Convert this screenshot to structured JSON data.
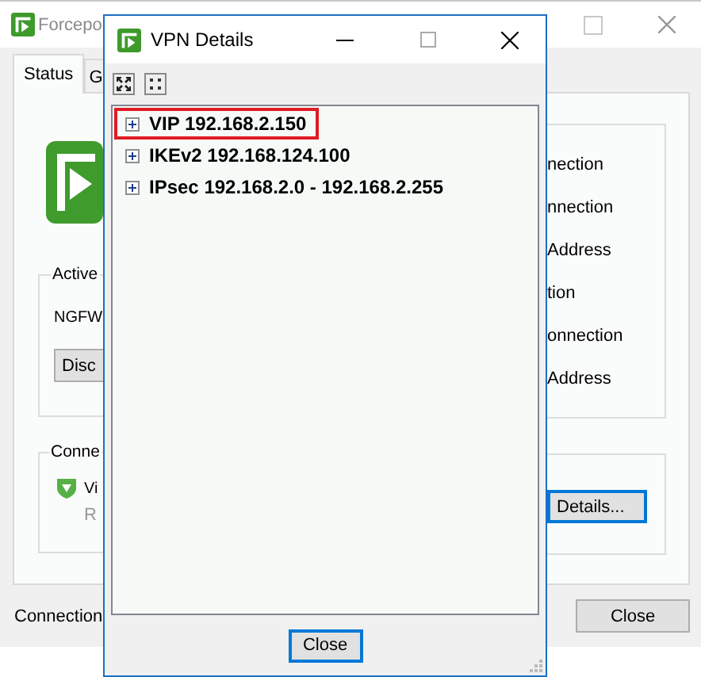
{
  "main_window": {
    "title": "Forcepo",
    "tabs": [
      {
        "label": "Status",
        "selected": true
      },
      {
        "label": "G",
        "selected": false
      }
    ],
    "active_group": {
      "title": "Active",
      "gateway": "NGFW",
      "button": "Disc"
    },
    "connection_group": {
      "title": "Conne",
      "name": "Vi",
      "detail": "R"
    },
    "status_labels": [
      "nection",
      "nnection",
      "Address",
      "tion",
      "onnection",
      "Address"
    ],
    "details_button": "Details...",
    "footer": {
      "label": "Connection",
      "close_button": "Close"
    }
  },
  "dialog": {
    "title": "VPN Details",
    "tree": [
      {
        "label": "VIP 192.168.2.150",
        "expanded": false,
        "selected": true
      },
      {
        "label": "IKEv2 192.168.124.100",
        "expanded": false,
        "selected": false
      },
      {
        "label": "IPsec 192.168.2.0 - 192.168.2.255",
        "expanded": false,
        "selected": false
      }
    ],
    "close_button": "Close"
  }
}
